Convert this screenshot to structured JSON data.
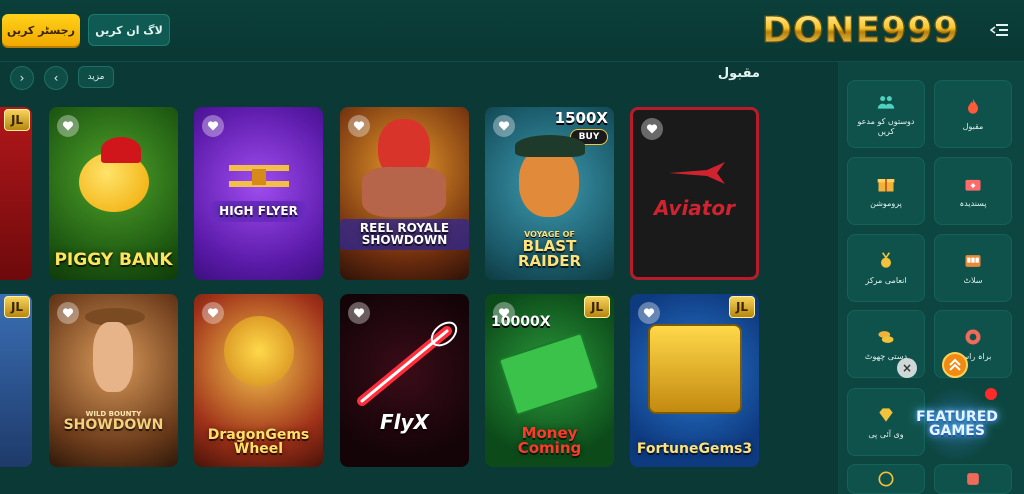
{
  "header": {
    "register_label": "رجسٹر کریں",
    "login_label": "لاگ ان کریں",
    "logo_text": "DONE999"
  },
  "section": {
    "title": "مقبول",
    "more_label": "مزید"
  },
  "games_row1": [
    {
      "title": "JL",
      "name": "partial-game"
    },
    {
      "title": "PIGGY BANK"
    },
    {
      "title": "HIGH FLYER"
    },
    {
      "title": "REEL ROYALE SHOWDOWN"
    },
    {
      "title": "BLAST RAIDER",
      "subtitle": "VOYAGE OF",
      "multiplier": "1500X",
      "buy": "BUY"
    },
    {
      "title": "Aviator"
    }
  ],
  "games_row2": [
    {
      "title": "JL"
    },
    {
      "title": "SHOWDOWN",
      "subtitle": "WILD BOUNTY"
    },
    {
      "title": "DragonGems Wheel"
    },
    {
      "title": "FlyX"
    },
    {
      "title": "Money Coming",
      "multiplier": "10000X",
      "badge": "JL"
    },
    {
      "title": "FortuneGems3",
      "badge": "JL"
    }
  ],
  "sidebar": {
    "categories": [
      {
        "label": "مقبول",
        "icon": "flame-icon"
      },
      {
        "label": "دوستوں کو مدعو کریں",
        "icon": "invite-friends-icon"
      },
      {
        "label": "پسندیدہ",
        "icon": "favorites-box-icon"
      },
      {
        "label": "پروموشن",
        "icon": "gift-icon"
      },
      {
        "label": "سلاٹ",
        "icon": "slot-machine-icon"
      },
      {
        "label": "انعامی مرکز",
        "icon": "medal-icon"
      },
      {
        "label": "براہ راست",
        "icon": "roulette-icon"
      },
      {
        "label": "دستی چھوٹ",
        "icon": "coins-icon"
      },
      {
        "label": "وی آئی پی",
        "icon": "diamond-icon"
      }
    ]
  },
  "floating": {
    "featured_label": "FEATURED GAMES",
    "close_label": "×"
  }
}
